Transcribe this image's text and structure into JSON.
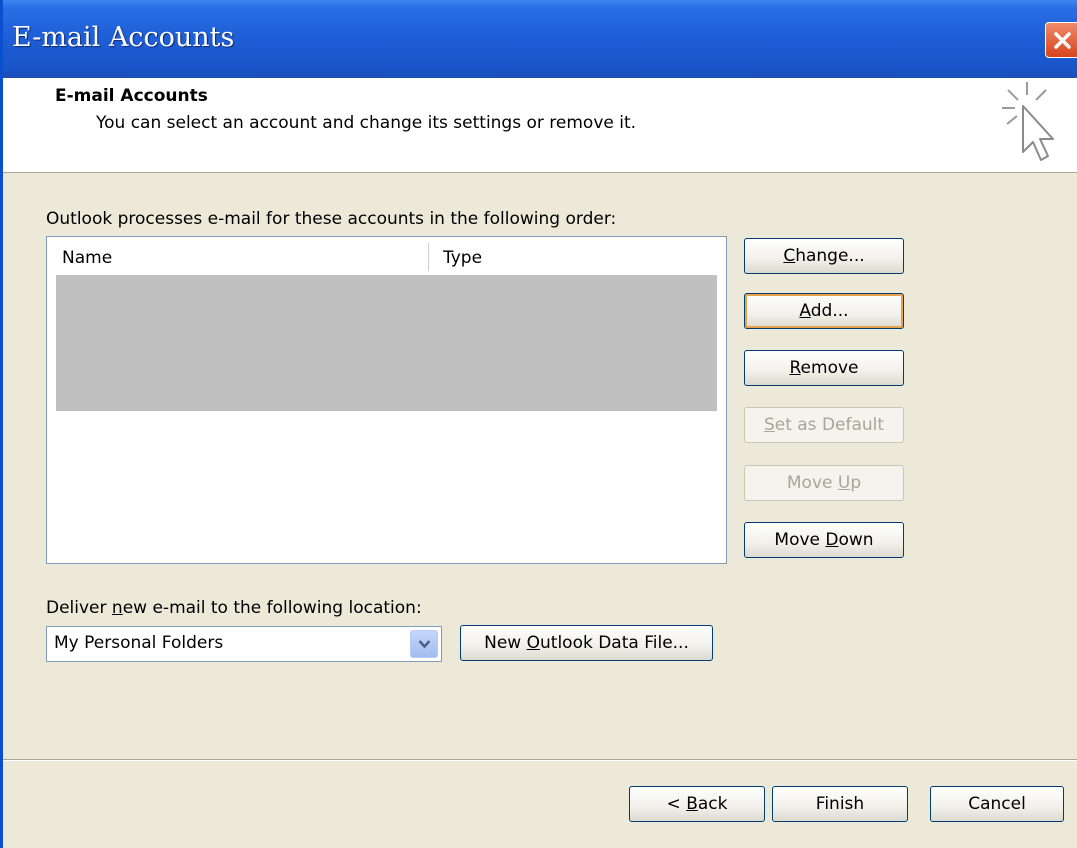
{
  "window": {
    "title": "E-mail Accounts"
  },
  "header": {
    "title": "E-mail Accounts",
    "subtitle": "You can select an account and change its settings or remove it."
  },
  "accounts": {
    "label": "Outlook processes e-mail for these accounts in the following order:",
    "columns": [
      "Name",
      "Type"
    ],
    "rows": []
  },
  "side_buttons": {
    "change": {
      "pre": "",
      "key": "C",
      "post": "hange..."
    },
    "add": {
      "pre": "",
      "key": "A",
      "post": "dd..."
    },
    "remove": {
      "pre": "",
      "key": "R",
      "post": "emove"
    },
    "set_default": {
      "pre": "",
      "key": "S",
      "post": "et as Default"
    },
    "move_up": {
      "pre": "Move ",
      "key": "U",
      "post": "p"
    },
    "move_down": {
      "pre": "Move ",
      "key": "D",
      "post": "own"
    }
  },
  "delivery": {
    "label_pre": "Deliver ",
    "label_key": "n",
    "label_post": "ew e-mail to the following location:",
    "selected": "My Personal Folders",
    "new_file": {
      "pre": "New ",
      "key": "O",
      "post": "utlook Data File..."
    }
  },
  "footer": {
    "back": {
      "pre": "< ",
      "key": "B",
      "post": "ack"
    },
    "finish": "Finish",
    "cancel": "Cancel"
  },
  "colors": {
    "titlebar": "#1f5fd8",
    "dialog_bg": "#ece9d8",
    "list_fill": "#c0c0c0",
    "default_highlight": "#e7a24a"
  },
  "icons": [
    "close-icon",
    "wizard-cursor-icon",
    "chevron-down-icon"
  ]
}
